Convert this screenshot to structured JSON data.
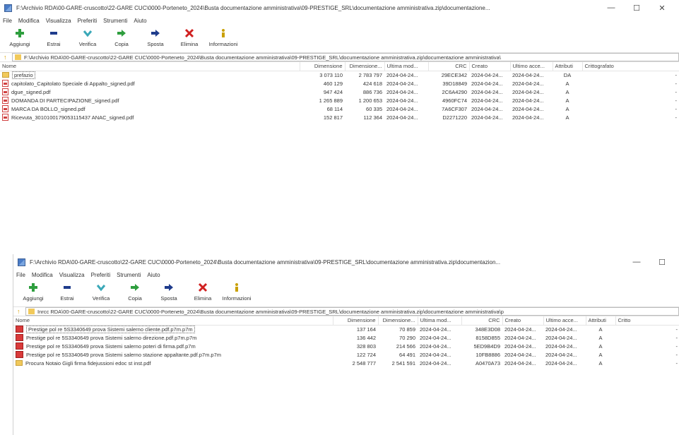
{
  "window1": {
    "title": "F:\\Archivio RDA\\00-GARE-cruscotto\\22-GARE CUC\\0000-Porteneto_2024\\Busta documentazione amministrativa\\09-PRESTIGE_SRL\\documentazione amministrativa.zip\\documentazione...",
    "menu": [
      "File",
      "Modifica",
      "Visualizza",
      "Preferiti",
      "Strumenti",
      "Aiuto"
    ],
    "toolbar": {
      "add": "Aggiungi",
      "extract": "Estrai",
      "verify": "Verifica",
      "copy": "Copia",
      "move": "Sposta",
      "delete": "Elimina",
      "info": "Informazioni"
    },
    "address": "F:\\Archivio RDA\\00-GARE-cruscotto\\22-GARE CUC\\0000-Porteneto_2024\\Busta documentazione amministrativa\\09-PRESTIGE_SRL\\documentazione amministrativa.zip\\documentazione amministrativa\\",
    "columns": {
      "name": "Nome",
      "size": "Dimensione",
      "packed": "Dimensione...",
      "modified": "Ultima mod...",
      "crc": "CRC",
      "created": "Creato",
      "accessed": "Ultimo acce...",
      "attr": "Attributi",
      "encrypted": "Crittografato"
    },
    "rows": [
      {
        "icon": "folder",
        "name": "prefazio",
        "size": "3 073 110",
        "packed": "2 783 797",
        "modified": "2024-04-24...",
        "crc": "29ECE342",
        "created": "2024-04-24...",
        "accessed": "2024-04-24...",
        "attr": "DA",
        "enc": "-"
      },
      {
        "icon": "pdf",
        "name": "capitolato_Capitolato Speciale di Appalto_signed.pdf",
        "size": "460 129",
        "packed": "424 618",
        "modified": "2024-04-24...",
        "crc": "39D18849",
        "created": "2024-04-24...",
        "accessed": "2024-04-24...",
        "attr": "A",
        "enc": "-"
      },
      {
        "icon": "pdf",
        "name": "dgue_signed.pdf",
        "size": "947 424",
        "packed": "886 736",
        "modified": "2024-04-24...",
        "crc": "2C6A4290",
        "created": "2024-04-24...",
        "accessed": "2024-04-24...",
        "attr": "A",
        "enc": "-"
      },
      {
        "icon": "pdf",
        "name": "DOMANDA DI PARTECIPAZIONE_signed.pdf",
        "size": "1 265 889",
        "packed": "1 200 653",
        "modified": "2024-04-24...",
        "crc": "4960FC74",
        "created": "2024-04-24...",
        "accessed": "2024-04-24...",
        "attr": "A",
        "enc": "-"
      },
      {
        "icon": "pdf",
        "name": "MARCA DA BOLLO_signed.pdf",
        "size": "68 114",
        "packed": "60 335",
        "modified": "2024-04-24...",
        "crc": "7A6CF307",
        "created": "2024-04-24...",
        "accessed": "2024-04-24...",
        "attr": "A",
        "enc": "-"
      },
      {
        "icon": "pdf",
        "name": "Ricevuta_3010100179053115437 ANAC_signed.pdf",
        "size": "152 817",
        "packed": "112 364",
        "modified": "2024-04-24...",
        "crc": "D2271220",
        "created": "2024-04-24...",
        "accessed": "2024-04-24...",
        "attr": "A",
        "enc": "-"
      }
    ]
  },
  "window2": {
    "title": "F:\\Archivio RDA\\00-GARE-cruscotto\\22-GARE CUC\\0000-Porteneto_2024\\Busta documentazione amministrativa\\09-PRESTIGE_SRL\\documentazione amministrativa.zip\\documentazion...",
    "menu": [
      "File",
      "Modifica",
      "Visualizza",
      "Preferiti",
      "Strumenti",
      "Aiuto"
    ],
    "toolbar": {
      "add": "Aggiungi",
      "extract": "Estrai",
      "verify": "Verifica",
      "copy": "Copia",
      "move": "Sposta",
      "delete": "Elimina",
      "info": "Informazioni"
    },
    "address": "Inrcc RDA\\00-GARE-cruscotto\\22-GARE CUC\\0000-Porteneto_2024\\Busta documentazione amministrativa\\09-PRESTIGE_SRL\\documentazione amministrativa.zip\\documentazione amministrativa\\p",
    "columns": {
      "name": "Nome",
      "size": "Dimensione",
      "packed": "Dimensione...",
      "modified": "Ultima mod...",
      "crc": "CRC",
      "created": "Creato",
      "accessed": "Ultimo acce...",
      "attr": "Attributi",
      "encrypted": "Critto"
    },
    "rows": [
      {
        "icon": "p7m",
        "name": "Prestige pol re 5S3340649 prova Sistemi salerno cliente.pdf.p7m.p7m",
        "size": "137 164",
        "packed": "70 859",
        "modified": "2024-04-24...",
        "crc": "348E3D08",
        "created": "2024-04-24...",
        "accessed": "2024-04-24...",
        "attr": "A",
        "enc": "-",
        "selected": true
      },
      {
        "icon": "p7m",
        "name": "Prestige pol re 5S3340649 prova Sistemi salerno direzione.pdf.p7m.p7m",
        "size": "136 442",
        "packed": "70 290",
        "modified": "2024-04-24...",
        "crc": "8158D855",
        "created": "2024-04-24...",
        "accessed": "2024-04-24...",
        "attr": "A",
        "enc": "-"
      },
      {
        "icon": "p7m",
        "name": "Prestige pol re 5S3340649 prova Sistemi salerno poteri di firma.pdf.p7m",
        "size": "328 803",
        "packed": "214 566",
        "modified": "2024-04-24...",
        "crc": "5ED9B4D9",
        "created": "2024-04-24...",
        "accessed": "2024-04-24...",
        "attr": "A",
        "enc": "-"
      },
      {
        "icon": "p7m",
        "name": "Prestige pol re 5S3340649 prova Sistemi salerno stazione appaltante.pdf.p7m.p7m",
        "size": "122 724",
        "packed": "64 491",
        "modified": "2024-04-24...",
        "crc": "10FB8886",
        "created": "2024-04-24...",
        "accessed": "2024-04-24...",
        "attr": "A",
        "enc": "-"
      },
      {
        "icon": "folder",
        "name": "Procura Notaio Gigli firma fidejussioni edoc st inst.pdf",
        "size": "2 548 777",
        "packed": "2 541 591",
        "modified": "2024-04-24...",
        "crc": "A0470A73",
        "created": "2024-04-24...",
        "accessed": "2024-04-24...",
        "attr": "A",
        "enc": "-"
      }
    ]
  },
  "icons": {
    "add": "green-plus-icon",
    "extract": "navy-minus-icon",
    "verify": "teal-check-icon",
    "copy": "green-arrow-right-icon",
    "move": "navy-arrow-right-icon",
    "delete": "red-x-icon",
    "info": "yellow-info-icon"
  }
}
